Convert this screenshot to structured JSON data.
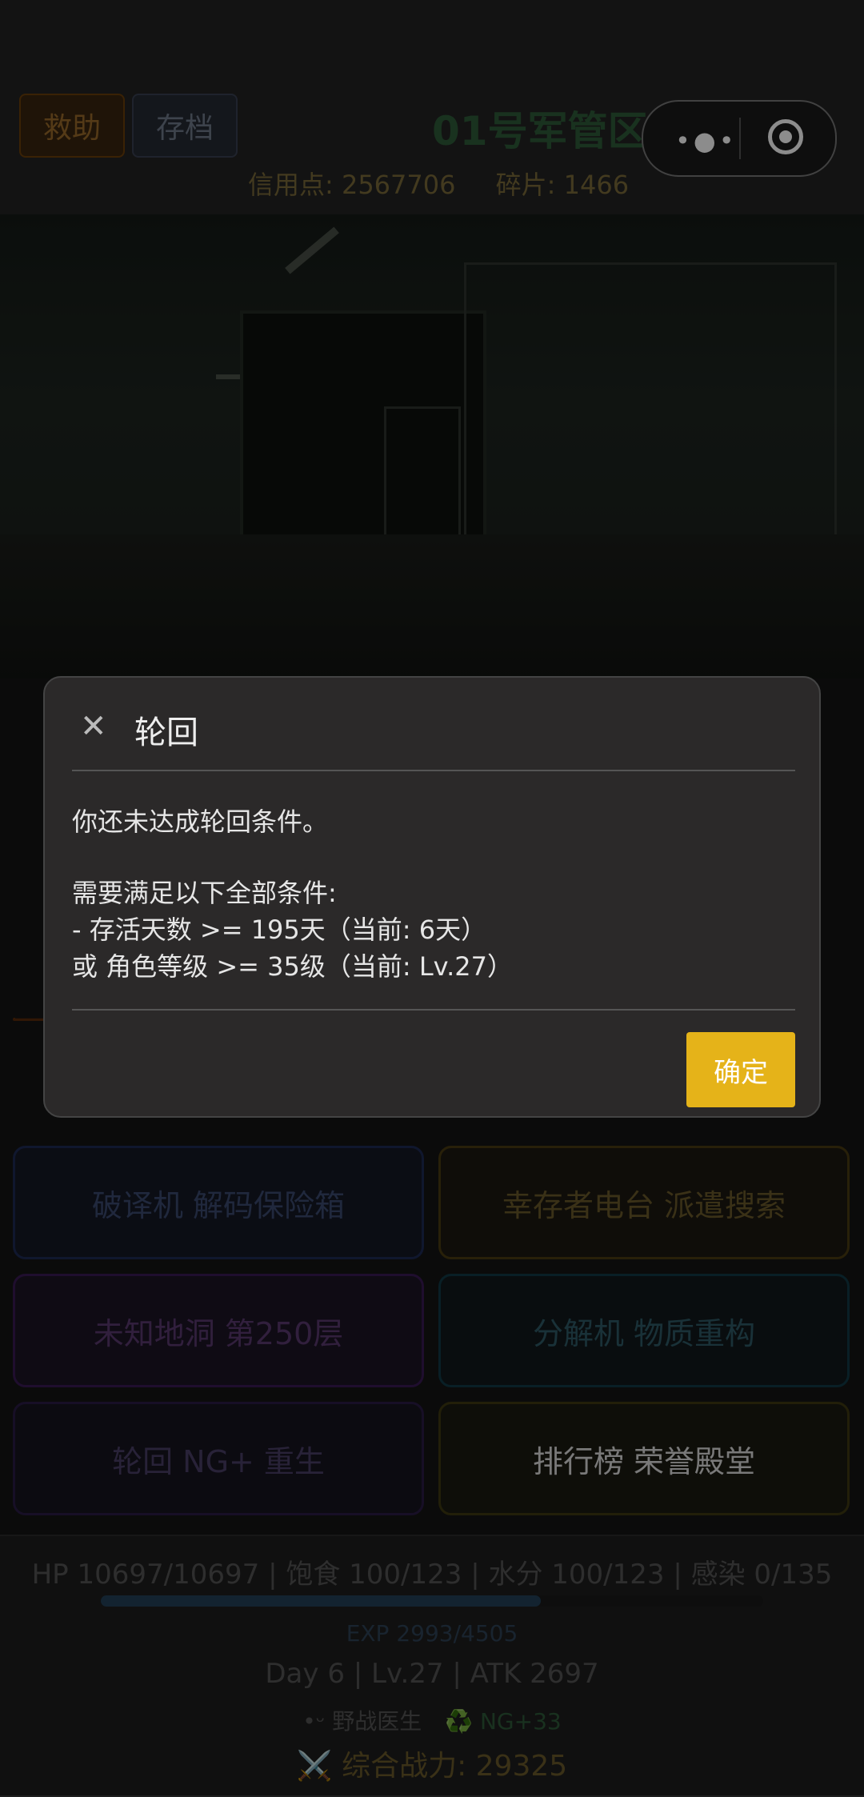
{
  "header": {
    "help_label": "救助",
    "save_label": "存档",
    "area_title": "01号军管区",
    "credits": "信用点: 2567706",
    "fragments": "碎片: 1466"
  },
  "menu": [
    {
      "label": "破译机 解码保险箱",
      "style": "t-blue"
    },
    {
      "label": "幸存者电台 派遣搜索",
      "style": "t-gold"
    },
    {
      "label": "未知地洞 第250层",
      "style": "t-purple"
    },
    {
      "label": "分解机 物质重构",
      "style": "t-teal"
    },
    {
      "label": "轮回 NG+ 重生",
      "style": "t-violet"
    },
    {
      "label": "排行榜 荣誉殿堂",
      "style": "t-olive"
    }
  ],
  "footer": {
    "status": "HP 10697/10697 | 饱食 100/123 | 水分 100/123 | 感染 0/135",
    "exp_text": "EXP 2993/4505",
    "exp_progress": 0.664,
    "day_line": "Day 6 | Lv.27 | ATK 2697",
    "class_name": "野战医生",
    "ng_level": "♻️ NG+33",
    "power": "⚔️ 综合战力: 29325"
  },
  "dialog": {
    "title": "轮回",
    "line1": "你还未达成轮回条件。",
    "line2": "需要满足以下全部条件:",
    "line3": "- 存活天数 >= 195天（当前: 6天）",
    "line4": "或 角色等级 >= 35级（当前: Lv.27）",
    "ok_label": "确定"
  }
}
